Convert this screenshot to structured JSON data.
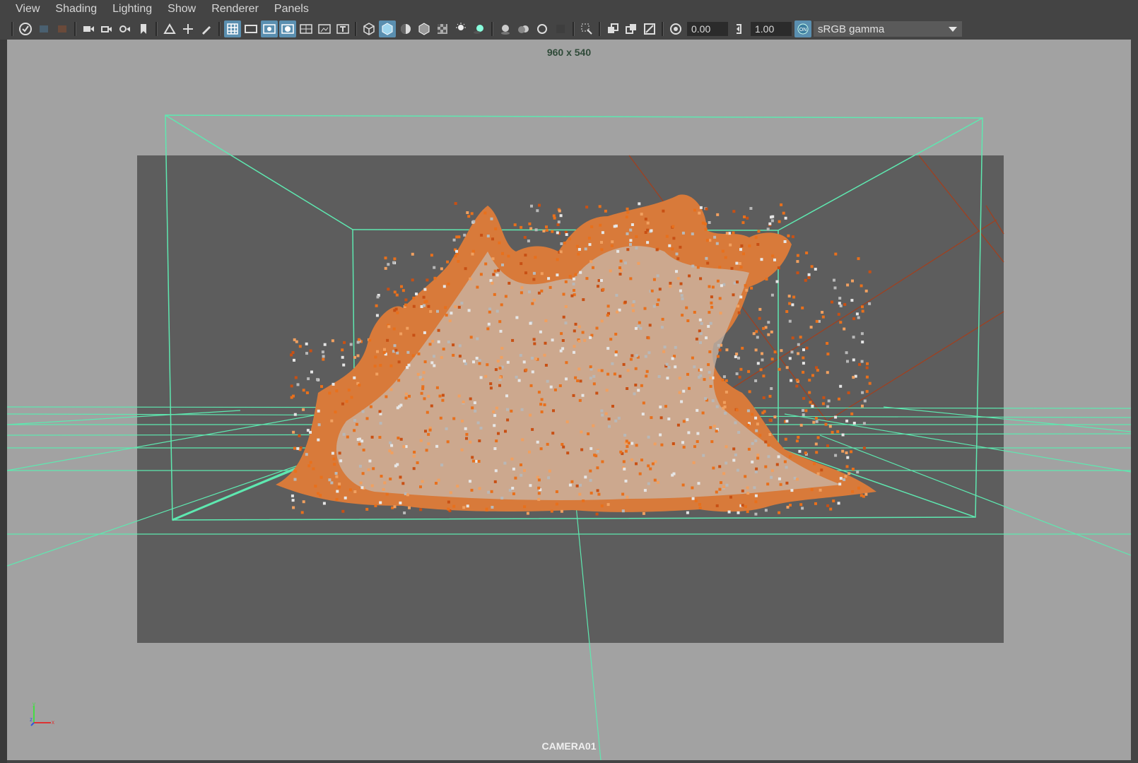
{
  "menu": [
    "View",
    "Shading",
    "Lighting",
    "Show",
    "Renderer",
    "Panels"
  ],
  "toolbar": {
    "exposure_value": "0.00",
    "gamma_value": "1.00",
    "colorspace_label": "sRGB gamma"
  },
  "viewport": {
    "resolution_label": "960 x 540",
    "camera_label": "CAMERA01"
  },
  "colors": {
    "wireframe": "#5ee8b0",
    "camera_frame": "#a04020",
    "particle_orange": "#e8701c",
    "particle_white": "#e6e6e6",
    "gate_mask": "#5d5d5d",
    "viewport_bg": "#a2a2a2"
  },
  "axis": {
    "y": "y",
    "z": "z",
    "x": "x"
  }
}
